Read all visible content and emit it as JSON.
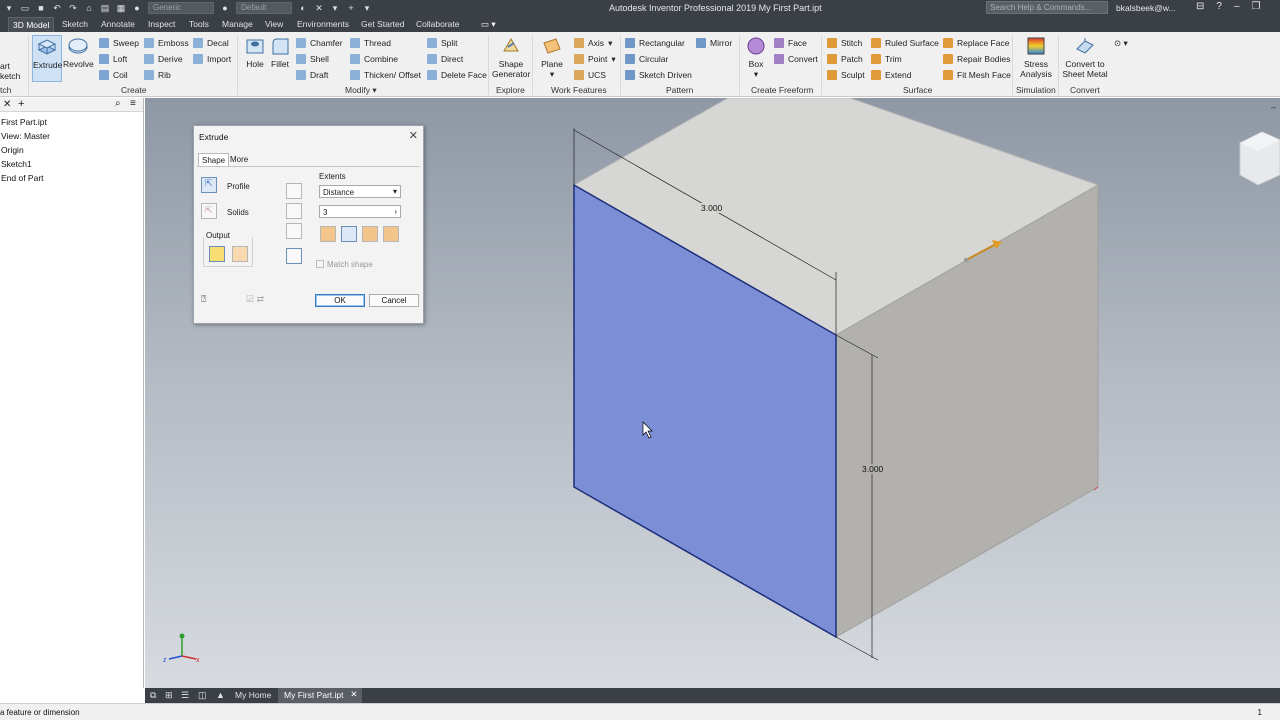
{
  "titlebar": {
    "appearance_combo": "Generic",
    "material_combo": "Default",
    "app_title": "Autodesk Inventor Professional 2019    My First Part.ipt",
    "search_placeholder": "Search Help & Commands...",
    "user": "bkalsbeek@w..."
  },
  "ribbon_tabs": [
    "3D Model",
    "Sketch",
    "Annotate",
    "Inspect",
    "Tools",
    "Manage",
    "View",
    "Environments",
    "Get Started",
    "Collaborate"
  ],
  "ribbon": {
    "sketch_partial_1": "art",
    "sketch_partial_2": "ketch",
    "sketch_group_partial": "tch",
    "extrude": "Extrude",
    "revolve": "Revolve",
    "create_small": [
      "Sweep",
      "Loft",
      "Coil",
      "Emboss",
      "Derive",
      "Rib",
      "Decal",
      "Import"
    ],
    "create_group": "Create",
    "hole": "Hole",
    "fillet": "Fillet",
    "modify_small": [
      "Chamfer",
      "Shell",
      "Draft",
      "Thread",
      "Combine",
      "Thicken/ Offset",
      "Split",
      "Direct",
      "Delete Face"
    ],
    "modify_group": "Modify",
    "shape_generator": "Shape Generator",
    "explore_group": "Explore",
    "plane": "Plane",
    "work_small": [
      "Axis",
      "Point",
      "UCS"
    ],
    "work_group": "Work Features",
    "pattern_small": [
      "Rectangular",
      "Circular",
      "Sketch Driven",
      "Mirror"
    ],
    "pattern_group": "Pattern",
    "box": "Box",
    "freeform_small": [
      "Face",
      "Convert"
    ],
    "freeform_group": "Create Freeform",
    "surface_small": [
      "Stitch",
      "Patch",
      "Sculpt",
      "Ruled Surface",
      "Trim",
      "Extend",
      "Replace Face",
      "Repair Bodies",
      "Fit Mesh Face"
    ],
    "surface_group": "Surface",
    "stress_analysis": "Stress Analysis",
    "simulation_group": "Simulation",
    "convert_sheet_metal": "Convert to Sheet Metal",
    "convert_group": "Convert"
  },
  "browser": {
    "items": [
      "First Part.ipt",
      "View: Master",
      "Origin",
      "Sketch1",
      "End of Part"
    ]
  },
  "dialog": {
    "title": "Extrude",
    "tabs": [
      "Shape",
      "More"
    ],
    "profile": "Profile",
    "solids": "Solids",
    "output": "Output",
    "extents": "Extents",
    "extents_type": "Distance",
    "distance_value": "3",
    "match_shape": "Match shape",
    "ok": "OK",
    "cancel": "Cancel"
  },
  "viewport": {
    "dimension_width": "3.000",
    "dimension_height": "3.000"
  },
  "bottom_tabs": [
    "My Home",
    "My First Part.ipt"
  ],
  "status": {
    "text": "a feature or dimension",
    "number": "1"
  },
  "colors": {
    "selected_face": "#7b8ed6",
    "title_bar": "#3b3f46",
    "ribbon_bg": "#f0f0f0",
    "accent_blue": "#3b78c2"
  },
  "icons": [
    "undo-icon",
    "redo-icon",
    "home-icon",
    "search-icon",
    "close-icon",
    "help-icon",
    "view-cube-icon"
  ]
}
